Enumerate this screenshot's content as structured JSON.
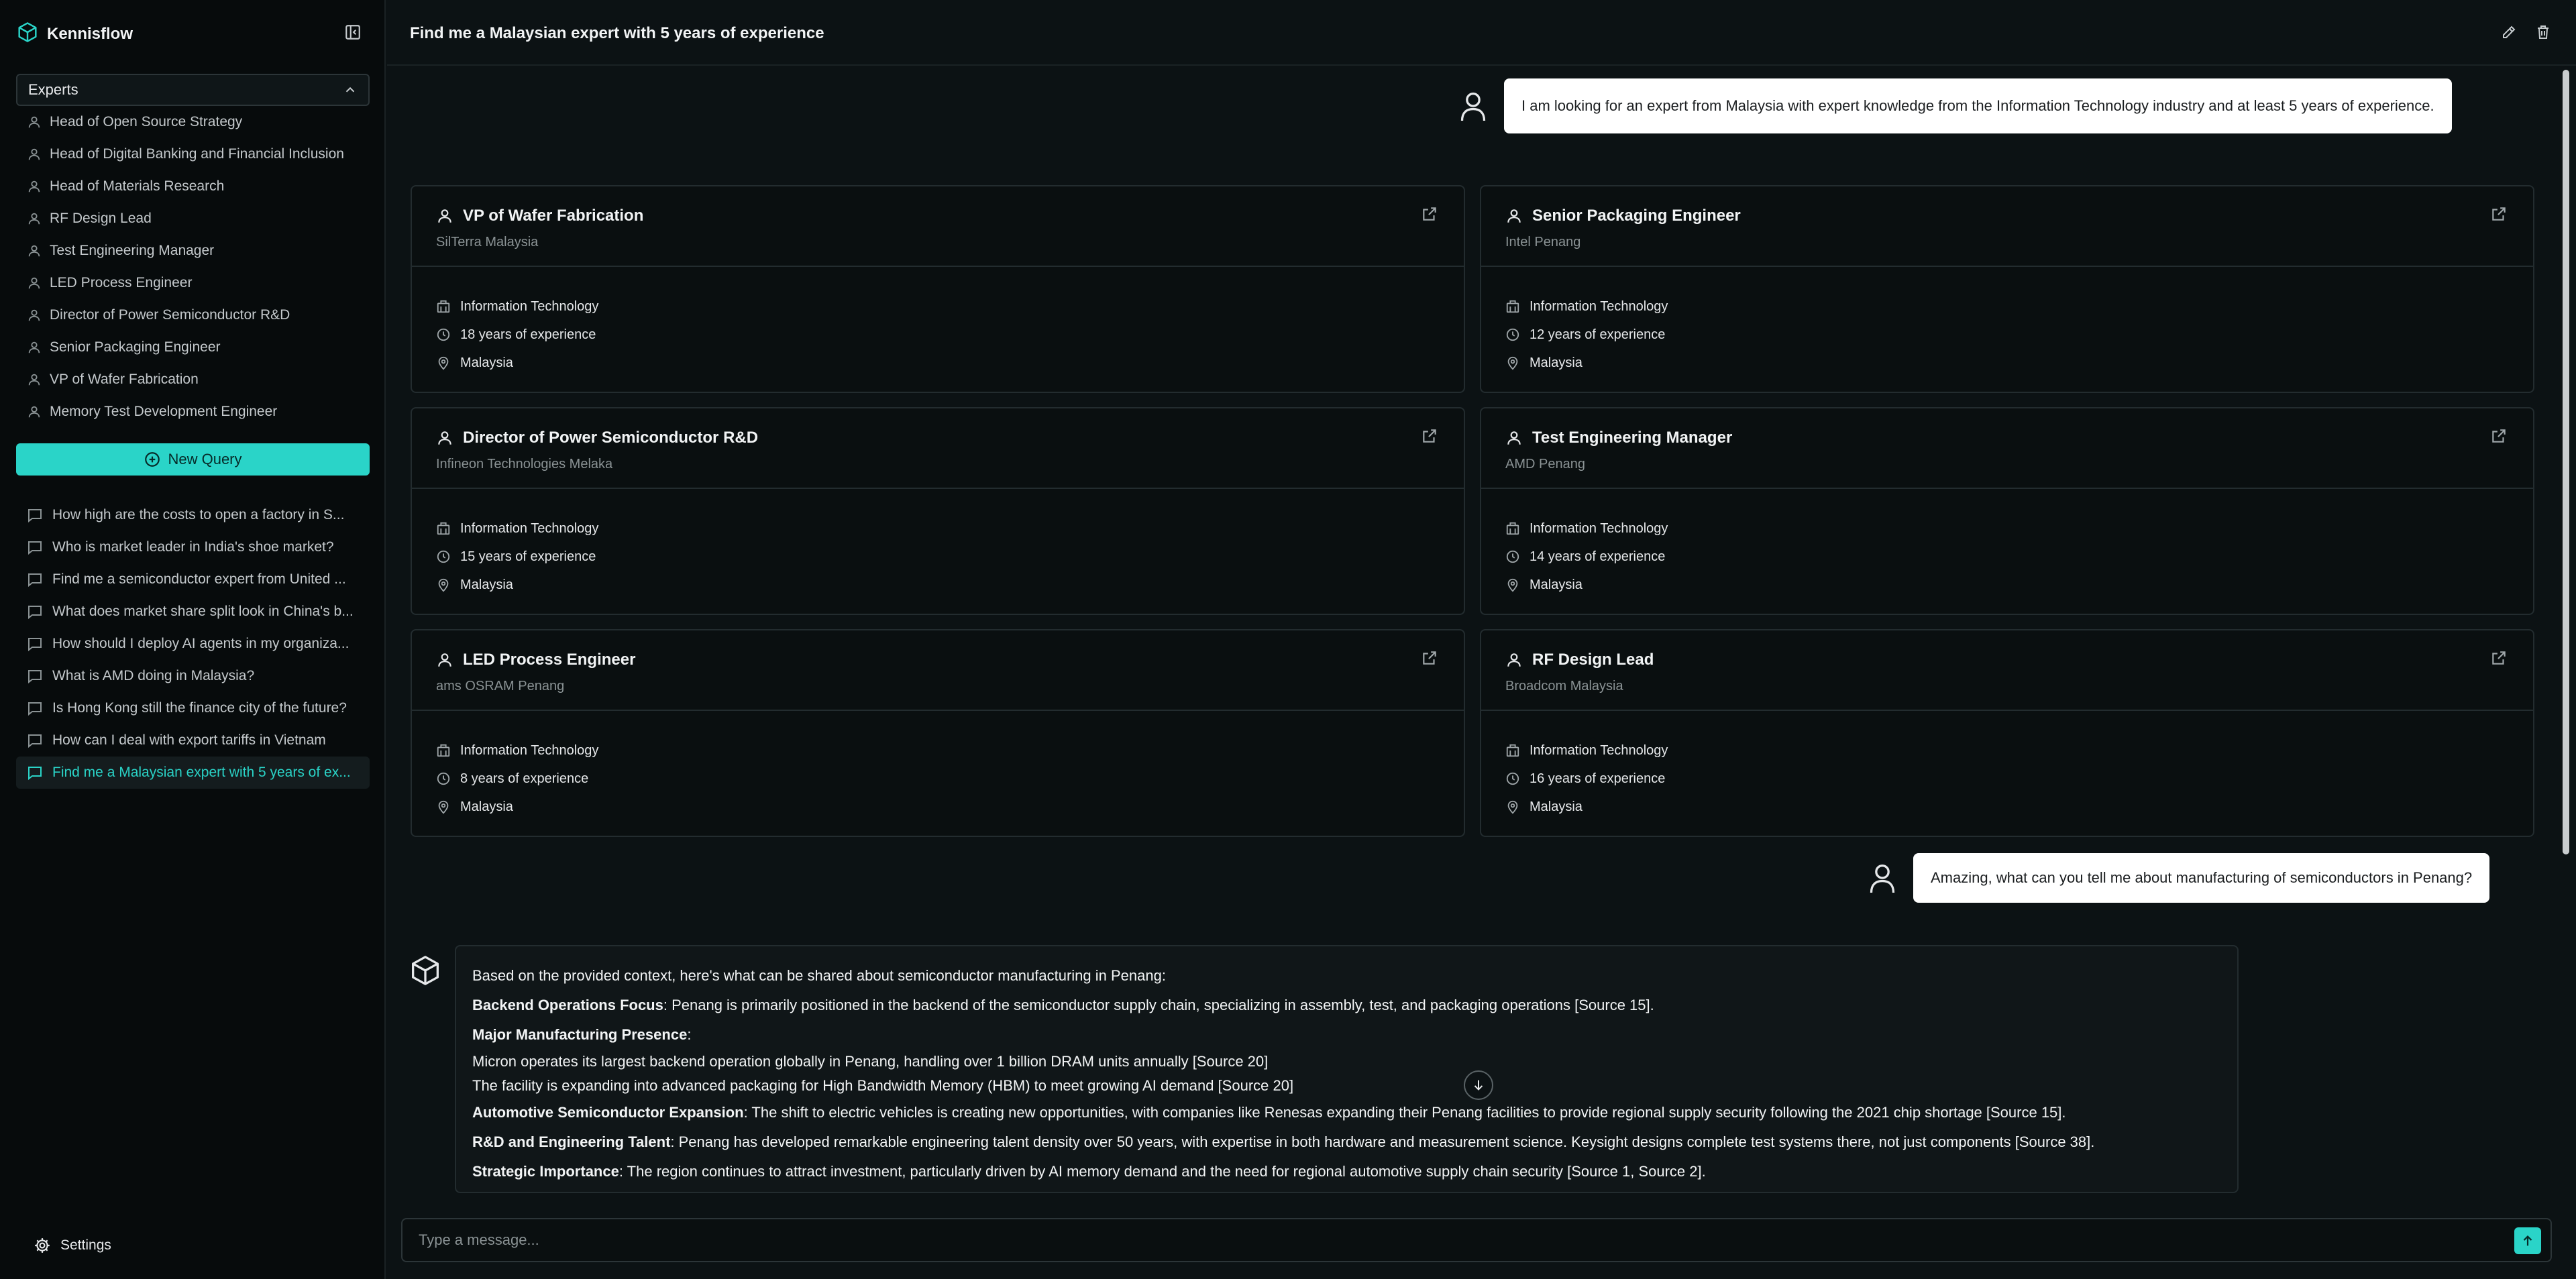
{
  "app": {
    "name": "Kennisflow"
  },
  "sidebar": {
    "section_label": "Experts",
    "experts": [
      "Head of Open Source Strategy",
      "Head of Digital Banking and Financial Inclusion",
      "Head of Materials Research",
      "RF Design Lead",
      "Test Engineering Manager",
      "LED Process Engineer",
      "Director of Power Semiconductor R&D",
      "Senior Packaging Engineer",
      "VP of Wafer Fabrication",
      "Memory Test Development Engineer"
    ],
    "new_query_label": "New Query",
    "history": [
      "How high are the costs to open a factory in S...",
      "Who is market leader in India's shoe market?",
      "Find me a semiconductor expert from United ...",
      "What does market share split look in China's b...",
      "How should I deploy AI agents in my organiza...",
      "What is AMD doing in Malaysia?",
      "Is Hong Kong still the finance city of the future?",
      "How can I deal with export tariffs in Vietnam",
      "Find me a Malaysian expert with 5 years of ex..."
    ],
    "settings_label": "Settings"
  },
  "header": {
    "title": "Find me a Malaysian expert with 5 years of experience"
  },
  "messages": {
    "user1": "I am looking for an expert from Malaysia with expert knowledge from the Information Technology industry and at least 5 years of experience.",
    "user2": "Amazing, what can you tell me about manufacturing of semiconductors in Penang?"
  },
  "cards": [
    {
      "title": "VP of Wafer Fabrication",
      "company": "SilTerra Malaysia",
      "industry": "Information Technology",
      "experience": "18 years of experience",
      "location": "Malaysia"
    },
    {
      "title": "Senior Packaging Engineer",
      "company": "Intel Penang",
      "industry": "Information Technology",
      "experience": "12 years of experience",
      "location": "Malaysia"
    },
    {
      "title": "Director of Power Semiconductor R&D",
      "company": "Infineon Technologies Melaka",
      "industry": "Information Technology",
      "experience": "15 years of experience",
      "location": "Malaysia"
    },
    {
      "title": "Test Engineering Manager",
      "company": "AMD Penang",
      "industry": "Information Technology",
      "experience": "14 years of experience",
      "location": "Malaysia"
    },
    {
      "title": "LED Process Engineer",
      "company": "ams OSRAM Penang",
      "industry": "Information Technology",
      "experience": "8 years of experience",
      "location": "Malaysia"
    },
    {
      "title": "RF Design Lead",
      "company": "Broadcom Malaysia",
      "industry": "Information Technology",
      "experience": "16 years of experience",
      "location": "Malaysia"
    }
  ],
  "answer": {
    "intro": "Based on the provided context, here's what can be shared about semiconductor manufacturing in Penang:",
    "p1_label": "Backend Operations Focus",
    "p1_text": ": Penang is primarily positioned in the backend of the semiconductor supply chain, specializing in assembly, test, and packaging operations [Source 15].",
    "p2_label": "Major Manufacturing Presence",
    "p2_text": ":",
    "p2_line1": "Micron operates its largest backend operation globally in Penang, handling over 1 billion DRAM units annually [Source 20]",
    "p2_line2": "The facility is expanding into advanced packaging for High Bandwidth Memory (HBM) to meet growing AI demand [Source 20]",
    "p3_label": "Automotive Semiconductor Expansion",
    "p3_text": ": The shift to electric vehicles is creating new opportunities, with companies like Renesas expanding their Penang facilities to provide regional supply security following the 2021 chip shortage [Source 15].",
    "p4_label": "R&D and Engineering Talent",
    "p4_text": ": Penang has developed remarkable engineering talent density over 50 years, with expertise in both hardware and measurement science. Keysight designs complete test systems there, not just components [Source 38].",
    "p5_label": "Strategic Importance",
    "p5_text": ": The region continues to attract investment, particularly driven by AI memory demand and the need for regional automotive supply chain security [Source 1, Source 2]."
  },
  "composer": {
    "placeholder": "Type a message..."
  },
  "colors": {
    "accent": "#2ad4c8",
    "background": "#0c1214",
    "sidebar": "#070b0c"
  },
  "icons": {
    "logo": "cube-icon",
    "collapse": "sidebar-collapse-icon",
    "expert": "user-icon",
    "history": "message-icon",
    "edit": "pencil-icon",
    "delete": "trash-icon",
    "external": "external-link-icon",
    "industry": "building-icon",
    "experience": "clock-icon",
    "location": "map-pin-icon",
    "send": "arrow-up-icon",
    "scroll": "arrow-down-icon",
    "settings": "gear-icon"
  }
}
